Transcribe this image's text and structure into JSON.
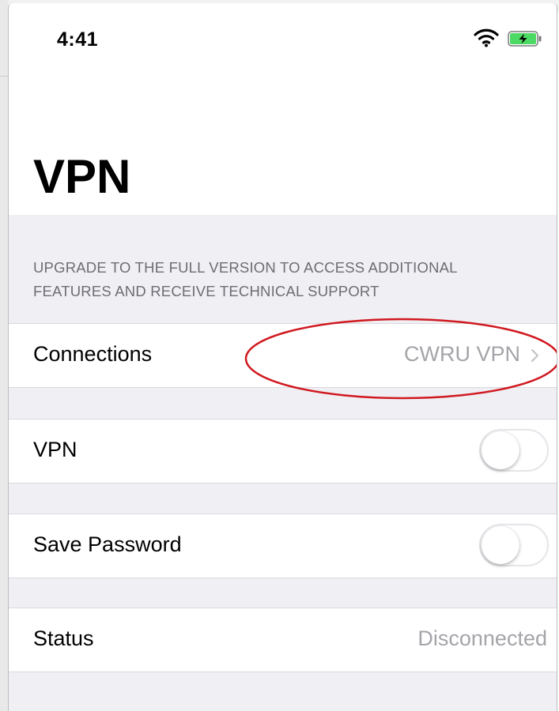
{
  "status_bar": {
    "time": "4:41",
    "icons": [
      "wifi-icon",
      "battery-charging-icon"
    ],
    "battery_color": "#4cd964"
  },
  "page": {
    "title": "VPN"
  },
  "upsell_notice": "UPGRADE TO THE FULL VERSION TO ACCESS ADDITIONAL FEATURES AND RECEIVE TECHNICAL SUPPORT",
  "settings": {
    "connections": {
      "label": "Connections",
      "value": "CWRU VPN",
      "icon": "chevron-right-icon"
    },
    "vpn": {
      "label": "VPN",
      "enabled": false
    },
    "save_password": {
      "label": "Save Password",
      "enabled": false
    },
    "status": {
      "label": "Status",
      "value": "Disconnected"
    }
  },
  "annotation": {
    "shape": "ellipse",
    "color": "#d0191f",
    "target": "connections-value"
  }
}
